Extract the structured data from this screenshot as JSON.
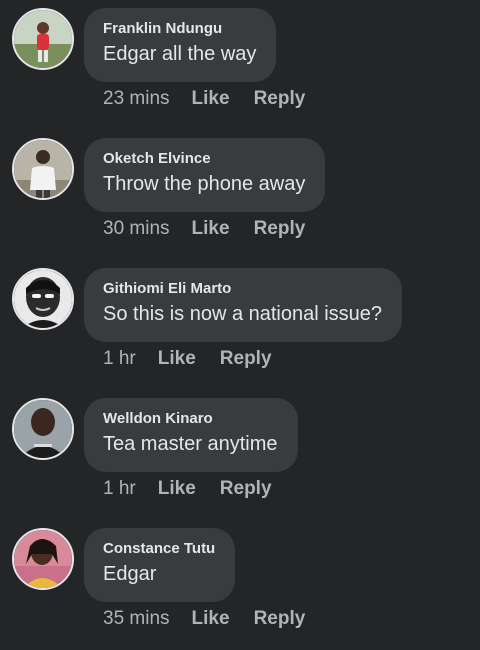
{
  "comments": [
    {
      "author": "Franklin Ndungu",
      "text": "Edgar all the way",
      "time": "23 mins",
      "like_label": "Like",
      "reply_label": "Reply"
    },
    {
      "author": "Oketch Elvince",
      "text": "Throw the phone away",
      "time": "30 mins",
      "like_label": "Like",
      "reply_label": "Reply"
    },
    {
      "author": "Githiomi Eli Marto",
      "text": "So this is now a national issue?",
      "time": "1 hr",
      "like_label": "Like",
      "reply_label": "Reply"
    },
    {
      "author": "Welldon Kinaro",
      "text": "Tea master anytime",
      "time": "1 hr",
      "like_label": "Like",
      "reply_label": "Reply"
    },
    {
      "author": "Constance Tutu",
      "text": "Edgar",
      "time": "35 mins",
      "like_label": "Like",
      "reply_label": "Reply"
    }
  ],
  "colors": {
    "background": "#242526",
    "bubble": "#3a3b3c",
    "text": "#e4e6eb",
    "secondary_text": "#b0b3b8"
  }
}
